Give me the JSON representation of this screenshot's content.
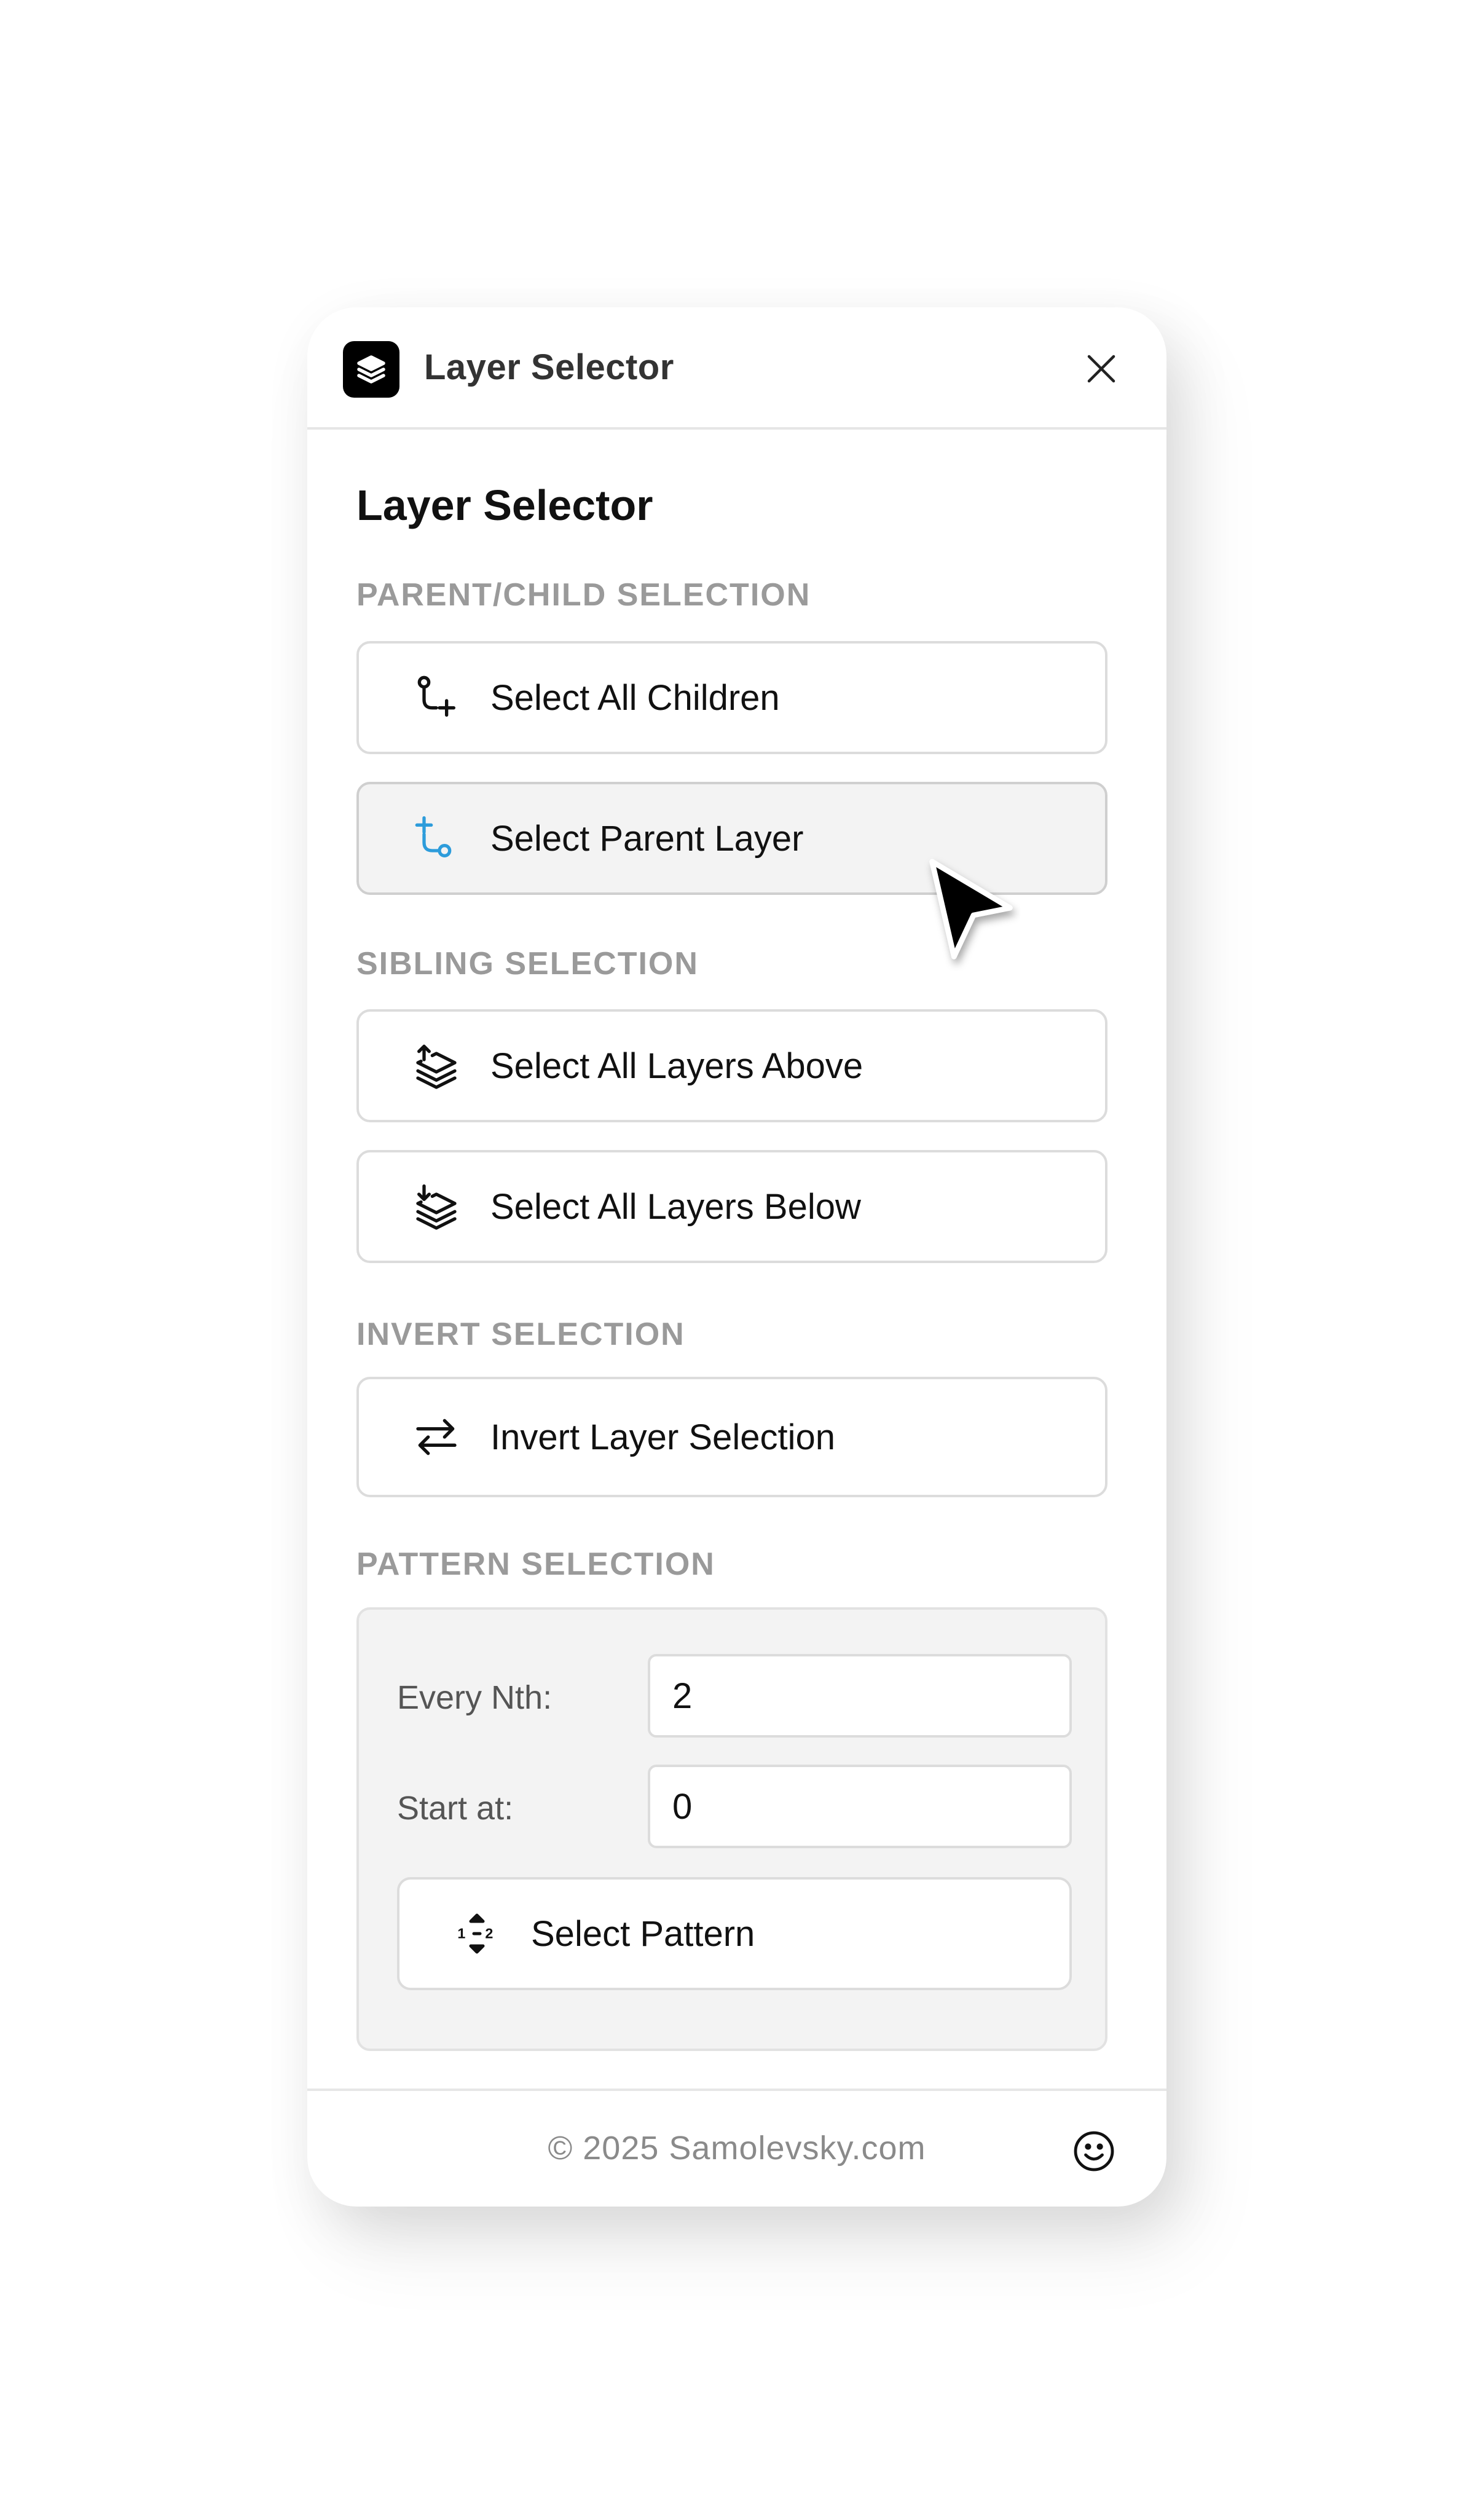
{
  "window": {
    "title": "Layer Selector",
    "close_icon": "close-icon",
    "app_icon": "layers-icon"
  },
  "main": {
    "heading": "Layer Selector"
  },
  "sections": {
    "parent_child": {
      "label": "PARENT/CHILD SELECTION",
      "select_all_children": {
        "label": "Select All Children",
        "icon": "children-branch-icon"
      },
      "select_parent_layer": {
        "label": "Select Parent Layer",
        "icon": "parent-branch-icon",
        "state": "hover",
        "icon_color": "#2d9cdb"
      }
    },
    "sibling": {
      "label": "SIBLING SELECTION",
      "select_layers_above": {
        "label": "Select All Layers Above",
        "icon": "layers-up-icon"
      },
      "select_layers_below": {
        "label": "Select All Layers Below",
        "icon": "layers-down-icon"
      }
    },
    "invert": {
      "label": "INVERT SELECTION",
      "invert_layer_selection": {
        "label": "Invert Layer Selection",
        "icon": "swap-arrows-icon"
      }
    },
    "pattern": {
      "label": "PATTERN SELECTION",
      "every_nth_label": "Every Nth:",
      "every_nth_value": "2",
      "start_at_label": "Start at:",
      "start_at_value": "0",
      "select_pattern": {
        "label": "Select Pattern",
        "icon": "pattern-icon"
      }
    }
  },
  "footer": {
    "copyright": "© 2025 Samolevsky.com",
    "smile_icon": "smiley-icon"
  },
  "colors": {
    "section_label": "#9a9a9a",
    "accent": "#2d9cdb",
    "hover_background": "#f3f3f3"
  }
}
